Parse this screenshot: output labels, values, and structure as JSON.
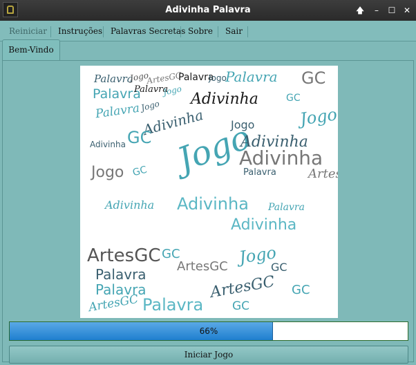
{
  "window": {
    "title": "Adivinha Palavra",
    "controls": [
      "🡅",
      "–",
      "☐",
      "✕"
    ]
  },
  "menu": {
    "items": [
      "Reiniciar",
      "Instruções",
      "Palavras Secretas",
      "Sobre",
      "Sair"
    ]
  },
  "tabs": [
    {
      "label": "Bem-Vindo"
    }
  ],
  "wordcloud": {
    "colors": {
      "teal": "#45a5b3",
      "cyan": "#5bb7c4",
      "dark": "#3a5f6f",
      "gray": "#777777",
      "black": "#1a1a1a"
    },
    "words": [
      {
        "t": "Palavra",
        "c": "#3a5f6f",
        "f": "cursive"
      },
      {
        "t": "Jogo",
        "c": "#555",
        "f": "cursive"
      },
      {
        "t": "ArtesGC",
        "c": "#777",
        "f": "cursive"
      },
      {
        "t": "Palavra",
        "c": "#1a1a1a",
        "f": "sans"
      },
      {
        "t": "Jogo",
        "c": "#3a5f6f",
        "f": "sans"
      },
      {
        "t": "Palavra",
        "c": "#45a5b3",
        "f": "cursive"
      },
      {
        "t": "GC",
        "c": "#777",
        "f": "sans"
      },
      {
        "t": "Palavra",
        "c": "#45a5b3",
        "f": "sans"
      },
      {
        "t": "Palavra",
        "c": "#1a1a1a",
        "f": "cursive"
      },
      {
        "t": "Jogo",
        "c": "#45a5b3",
        "f": "cursive"
      },
      {
        "t": "Adivinha",
        "c": "#1a1a1a",
        "f": "cursive"
      },
      {
        "t": "GC",
        "c": "#45a5b3",
        "f": "sans"
      },
      {
        "t": "Palavra",
        "c": "#45a5b3",
        "f": "cursive"
      },
      {
        "t": "Jogo",
        "c": "#3a5f6f",
        "f": "cursive"
      },
      {
        "t": "Adivinha",
        "c": "#3a5f6f",
        "f": "cursive"
      },
      {
        "t": "Jogo",
        "c": "#3a5f6f",
        "f": "sans"
      },
      {
        "t": "Jogo",
        "c": "#45a5b3",
        "f": "cursive"
      },
      {
        "t": "Adivinha",
        "c": "#3a5f6f",
        "f": "sans"
      },
      {
        "t": "GC",
        "c": "#45a5b3",
        "f": "sans"
      },
      {
        "t": "Jogo",
        "c": "#45a5b3",
        "f": "cursive"
      },
      {
        "t": "Adivinha",
        "c": "#3a5f6f",
        "f": "cursive"
      },
      {
        "t": "Adivinha",
        "c": "#777",
        "f": "sans"
      },
      {
        "t": "Jogo",
        "c": "#777",
        "f": "sans"
      },
      {
        "t": "GC",
        "c": "#45a5b3",
        "f": "sans"
      },
      {
        "t": "Palavra",
        "c": "#3a5f6f",
        "f": "sans"
      },
      {
        "t": "ArtesGC",
        "c": "#777",
        "f": "cursive"
      },
      {
        "t": "Adivinha",
        "c": "#45a5b3",
        "f": "cursive"
      },
      {
        "t": "Adivinha",
        "c": "#5bb7c4",
        "f": "sans"
      },
      {
        "t": "Palavra",
        "c": "#45a5b3",
        "f": "cursive"
      },
      {
        "t": "Adivinha",
        "c": "#5bb7c4",
        "f": "sans"
      },
      {
        "t": "ArtesGC",
        "c": "#555",
        "f": "sans"
      },
      {
        "t": "Palavra",
        "c": "#3a5f6f",
        "f": "sans"
      },
      {
        "t": "GC",
        "c": "#45a5b3",
        "f": "sans"
      },
      {
        "t": "ArtesGC",
        "c": "#777",
        "f": "sans"
      },
      {
        "t": "Jogo",
        "c": "#45a5b3",
        "f": "cursive"
      },
      {
        "t": "GC",
        "c": "#3a5f6f",
        "f": "sans"
      },
      {
        "t": "Palavra",
        "c": "#45a5b3",
        "f": "sans"
      },
      {
        "t": "ArtesGC",
        "c": "#3a5f6f",
        "f": "cursive"
      },
      {
        "t": "GC",
        "c": "#45a5b3",
        "f": "sans"
      },
      {
        "t": "Palavra",
        "c": "#5bb7c4",
        "f": "sans"
      },
      {
        "t": "GC",
        "c": "#45a5b3",
        "f": "sans"
      },
      {
        "t": "ArtesGC",
        "c": "#45a5b3",
        "f": "cursive"
      }
    ]
  },
  "progress": {
    "value": 66,
    "label": "66%"
  },
  "buttons": {
    "start": "Iniciar Jogo"
  }
}
